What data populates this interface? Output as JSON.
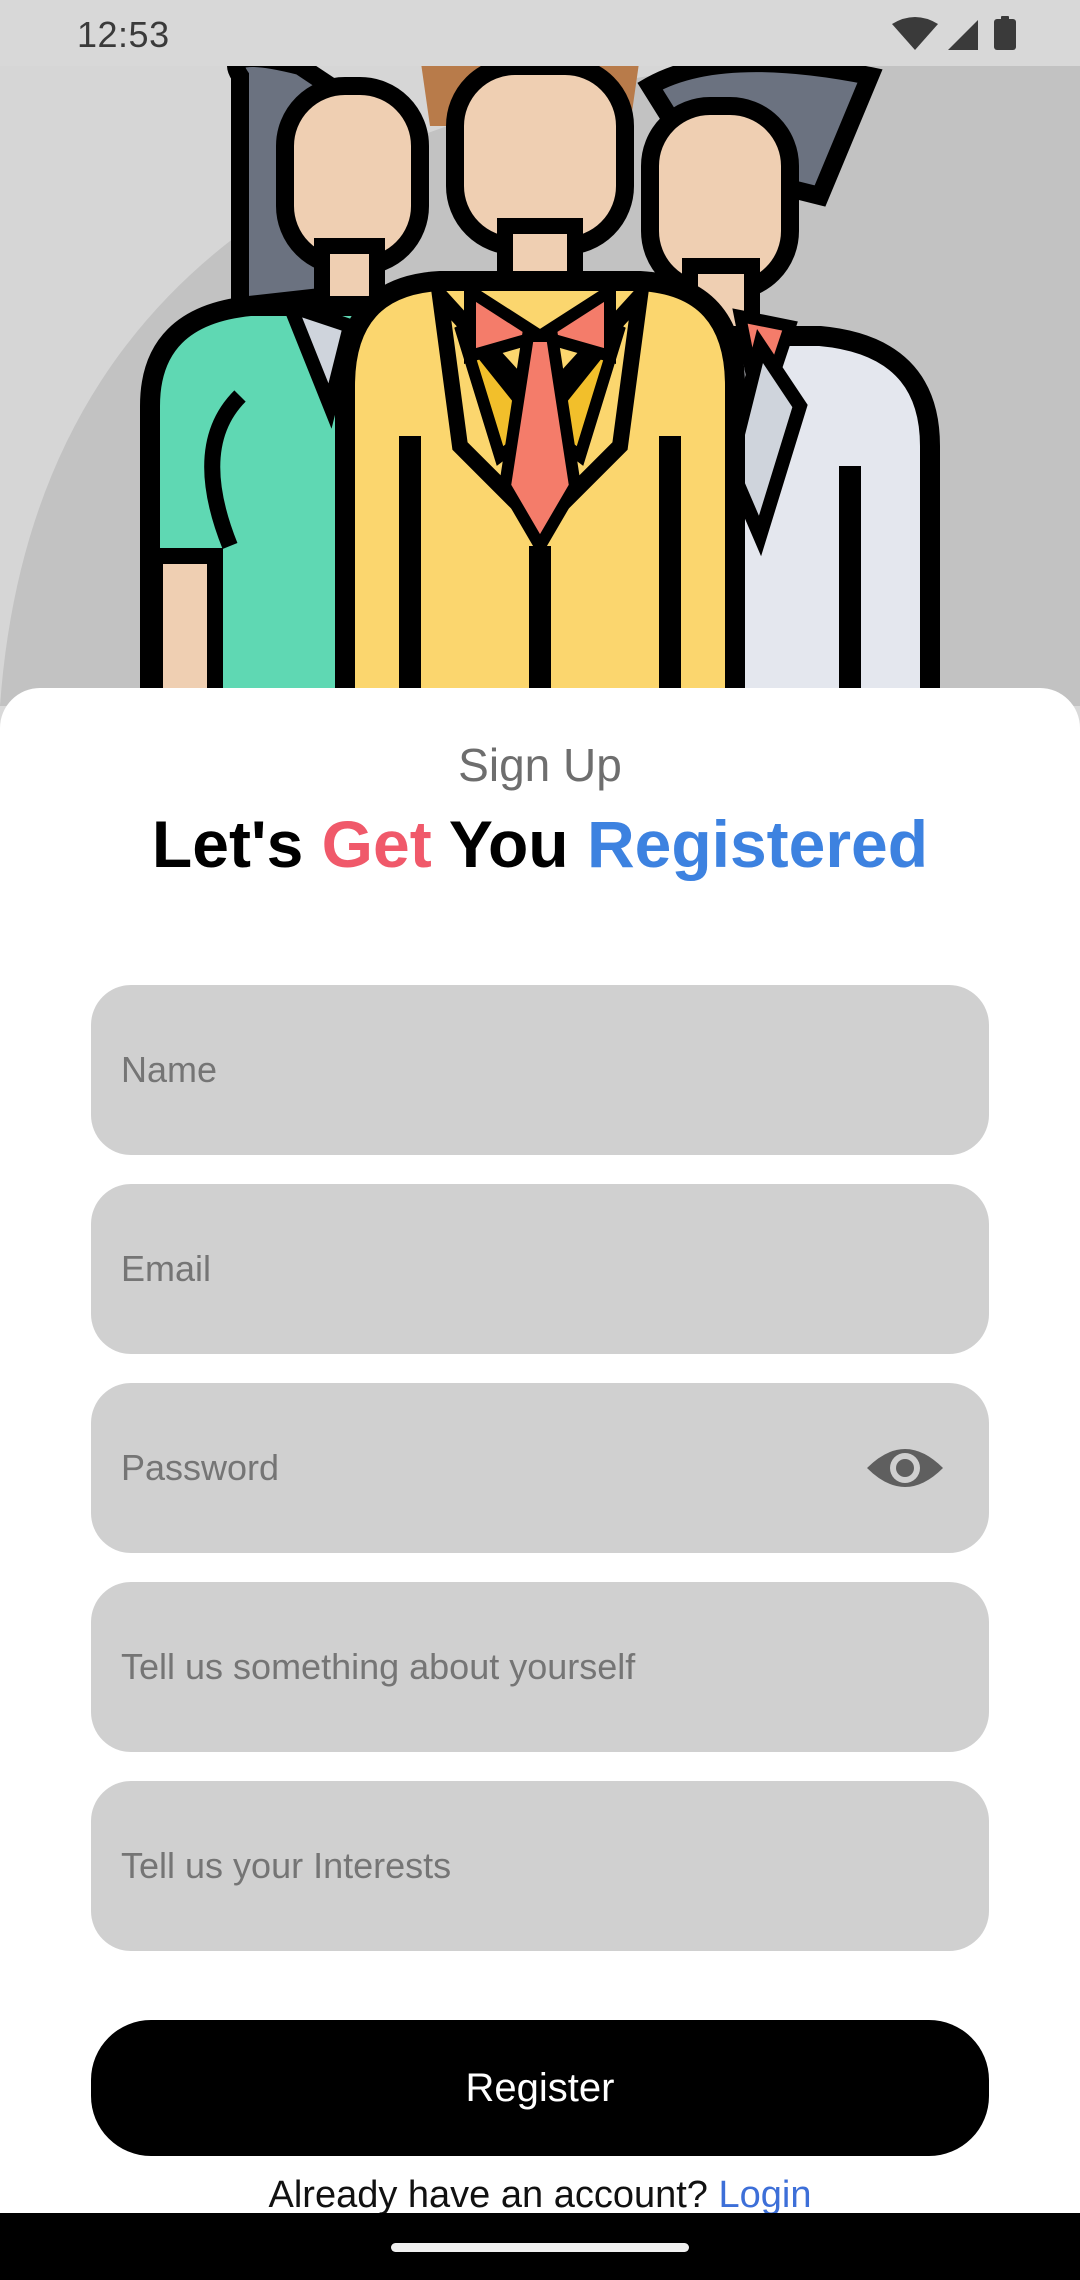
{
  "status_bar": {
    "time": "12:53",
    "icons": [
      "wifi-icon",
      "cellular-signal-icon",
      "battery-icon"
    ]
  },
  "hero": {
    "illustration": "people-group-illustration"
  },
  "signup": {
    "subtitle": "Sign Up",
    "title_parts": [
      "Let's ",
      "Get",
      " You ",
      "Registered"
    ],
    "title_colors": {
      "accent_red": "#f0596a",
      "accent_blue": "#3d82e0"
    }
  },
  "form": {
    "name_placeholder": "Name",
    "email_placeholder": "Email",
    "password_placeholder": "Password",
    "about_placeholder": "Tell us something about yourself",
    "interests_placeholder": "Tell us your Interests",
    "password_toggle_icon": "eye-icon"
  },
  "actions": {
    "register_label": "Register",
    "login_prompt": "Already have an account?",
    "login_link": "Login"
  },
  "colors": {
    "field_bg": "#d0d0d0",
    "button_bg": "#000000",
    "link": "#3d6fd8"
  }
}
